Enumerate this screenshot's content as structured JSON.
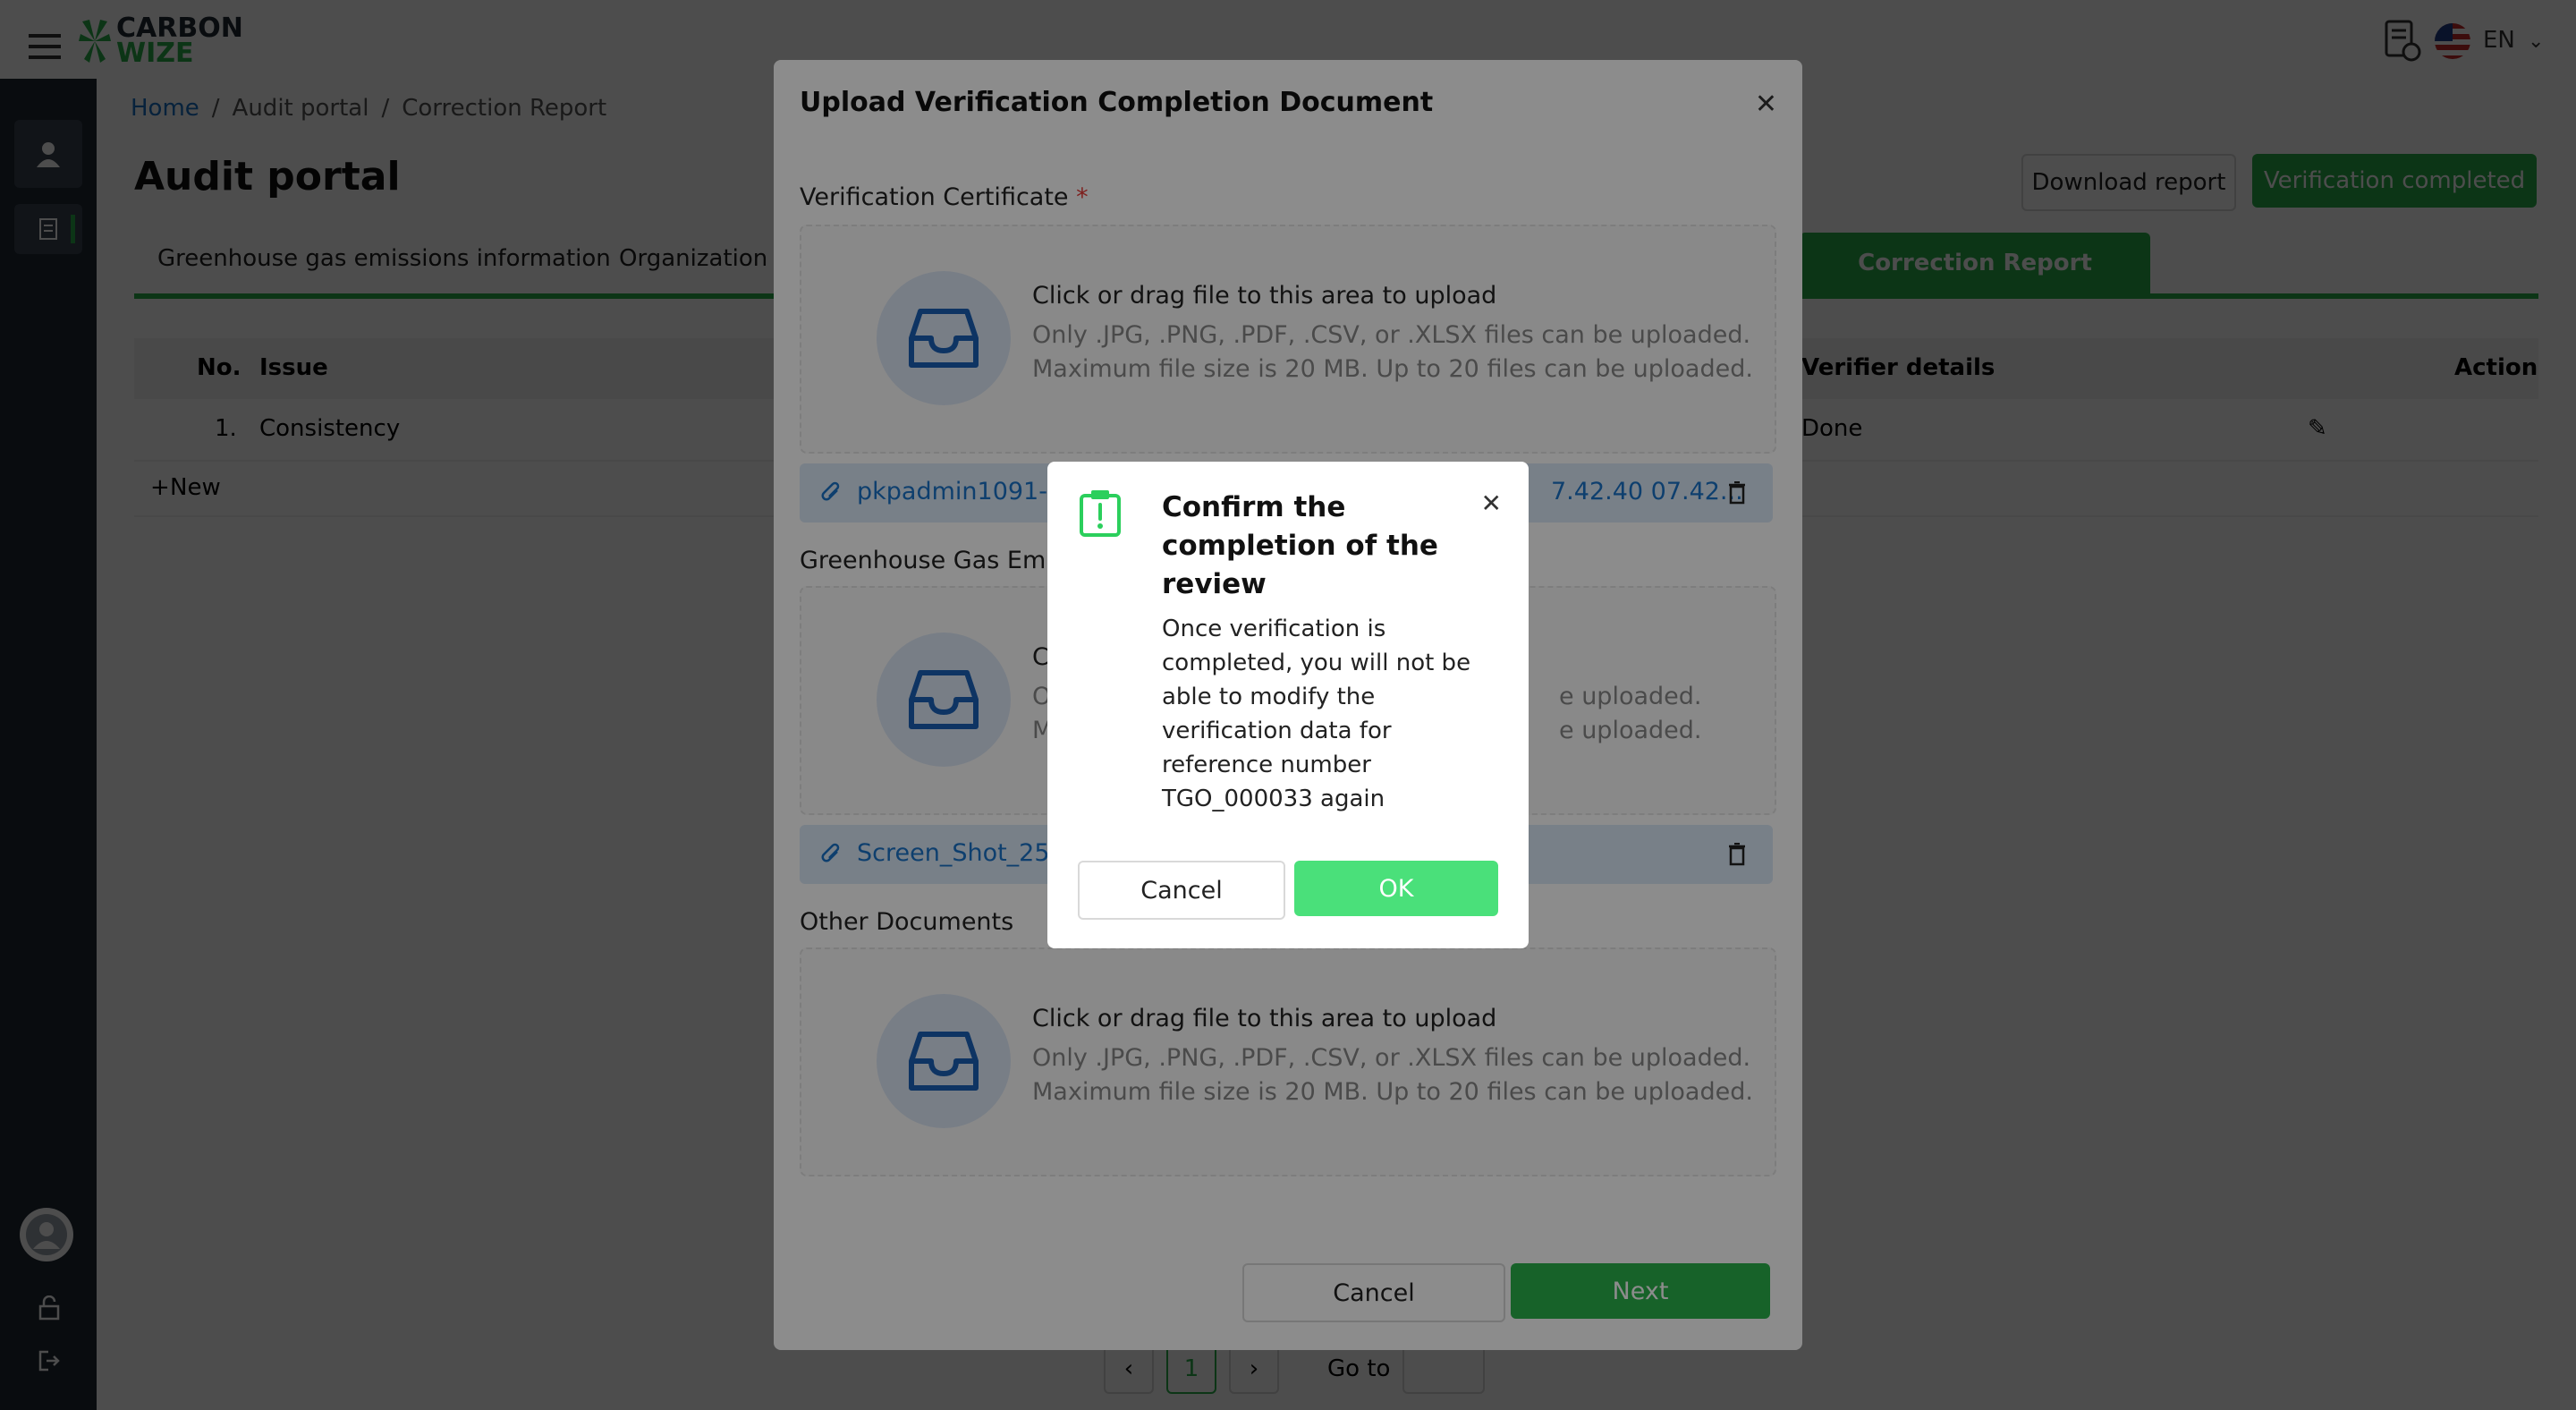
{
  "app": {
    "logo_line1": "CARBON",
    "logo_line2": "WIZE",
    "language": "EN"
  },
  "breadcrumb": {
    "home": "Home",
    "sep1": "/",
    "audit": "Audit portal",
    "sep2": "/",
    "current": "Correction Report"
  },
  "page": {
    "title": "Audit portal",
    "download_report": "Download report",
    "verification_completed": "Verification completed"
  },
  "tabs": {
    "ghg": "Greenhouse gas emissions information",
    "org": "Organization I",
    "correction": "Correction Report"
  },
  "table": {
    "headers": {
      "no": "No.",
      "issue": "Issue",
      "verifier": "Verifier details",
      "action": "Action"
    },
    "rows": [
      {
        "no": "1.",
        "issue": "Consistency",
        "verifier": "Done"
      }
    ],
    "new_label": "New"
  },
  "pagination": {
    "page": "1",
    "goto": "Go to"
  },
  "upload_modal": {
    "title": "Upload Verification Completion Document",
    "section1_label": "Verification Certificate",
    "required_mark": "*",
    "section2_label": "Greenhouse Gas Emiss",
    "section3_label": "Other Documents",
    "dz_main": "Click or drag file to this area to upload",
    "dz_sub1": "Only .JPG, .PNG, .PDF, .CSV, or .XLSX files can be uploaded.",
    "dz_sub2": "Maximum file size is 20 MB. Up to 20 files can be uploaded.",
    "dz2_main_fragment": "C",
    "dz2_sub1_left": "O",
    "dz2_sub1_right": "e uploaded.",
    "dz2_sub2_left": "M",
    "dz2_sub2_right": "e uploaded.",
    "file1_left": "pkpadmin1091-50",
    "file1_right": "7.42.40 07.42...",
    "file2_left": "Screen_Shot_2567",
    "cancel": "Cancel",
    "next": "Next"
  },
  "confirm": {
    "title": "Confirm the completion of the review",
    "body": "Once verification is completed, you will not be able to modify the verification data for reference number TGO_000033 again",
    "cancel": "Cancel",
    "ok": "OK"
  },
  "colors": {
    "brand_green": "#2bb24c",
    "ok_green": "#4ae07a",
    "link_blue": "#1a73c8",
    "sidebar": "#1f2a36"
  }
}
